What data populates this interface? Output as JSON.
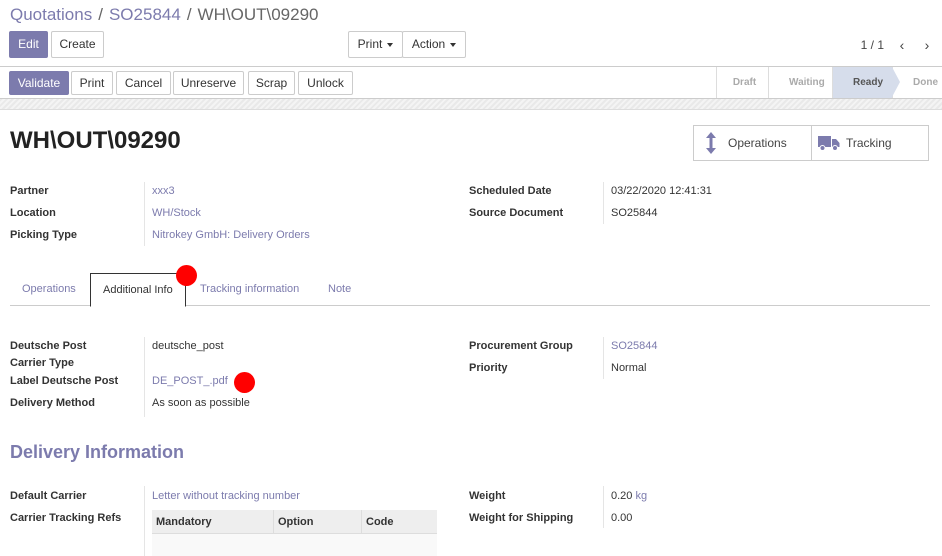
{
  "breadcrumb": {
    "items": [
      "Quotations",
      "SO25844"
    ],
    "sep": "/",
    "current": "WH\\OUT\\09290"
  },
  "toolbar": {
    "edit": "Edit",
    "create": "Create",
    "print": "Print",
    "action": "Action"
  },
  "pager": {
    "value": "1 / 1",
    "prev": "‹",
    "next": "›"
  },
  "statusbar": {
    "buttons": [
      "Validate",
      "Print",
      "Cancel",
      "Unreserve",
      "Scrap",
      "Unlock"
    ],
    "stages": [
      "Draft",
      "Waiting",
      "Ready",
      "Done"
    ],
    "active_stage": "Ready"
  },
  "record": {
    "title": "WH\\OUT\\09290"
  },
  "smart_buttons": {
    "operations": "Operations",
    "tracking": "Tracking"
  },
  "fields": {
    "partner": {
      "label": "Partner",
      "value": "xxx3"
    },
    "location": {
      "label": "Location",
      "value": "WH/Stock"
    },
    "picking_type": {
      "label": "Picking Type",
      "value": "Nitrokey GmbH: Delivery Orders"
    },
    "scheduled_date": {
      "label": "Scheduled Date",
      "value": "03/22/2020 12:41:31"
    },
    "source_document": {
      "label": "Source Document",
      "value": "SO25844"
    }
  },
  "tabs": [
    "Operations",
    "Additional Info",
    "Tracking information",
    "Note"
  ],
  "additional_info": {
    "deutsche_post": {
      "label": "Deutsche Post",
      "value": "deutsche_post"
    },
    "carrier_type": {
      "label": "Carrier Type",
      "value": ""
    },
    "label_deutsche_post": {
      "label": "Label Deutsche Post",
      "value": "DE_POST_.pdf"
    },
    "delivery_method": {
      "label": "Delivery Method",
      "value": "As soon as possible"
    },
    "procurement_group": {
      "label": "Procurement Group",
      "value": "SO25844"
    },
    "priority": {
      "label": "Priority",
      "value": "Normal"
    }
  },
  "delivery": {
    "title": "Delivery Information",
    "default_carrier": {
      "label": "Default Carrier",
      "value": "Letter without tracking number"
    },
    "carrier_tracking_refs": {
      "label": "Carrier Tracking Refs"
    },
    "table_headers": [
      "Mandatory",
      "Option",
      "Code"
    ],
    "weight": {
      "label": "Weight",
      "value": "0.20",
      "unit": "kg"
    },
    "weight_shipping": {
      "label": "Weight for Shipping",
      "value": "0.00"
    }
  },
  "colors": {
    "brand": "#7c7bad",
    "stage_active": "#d6ddeb",
    "marker": "#ff0000"
  }
}
